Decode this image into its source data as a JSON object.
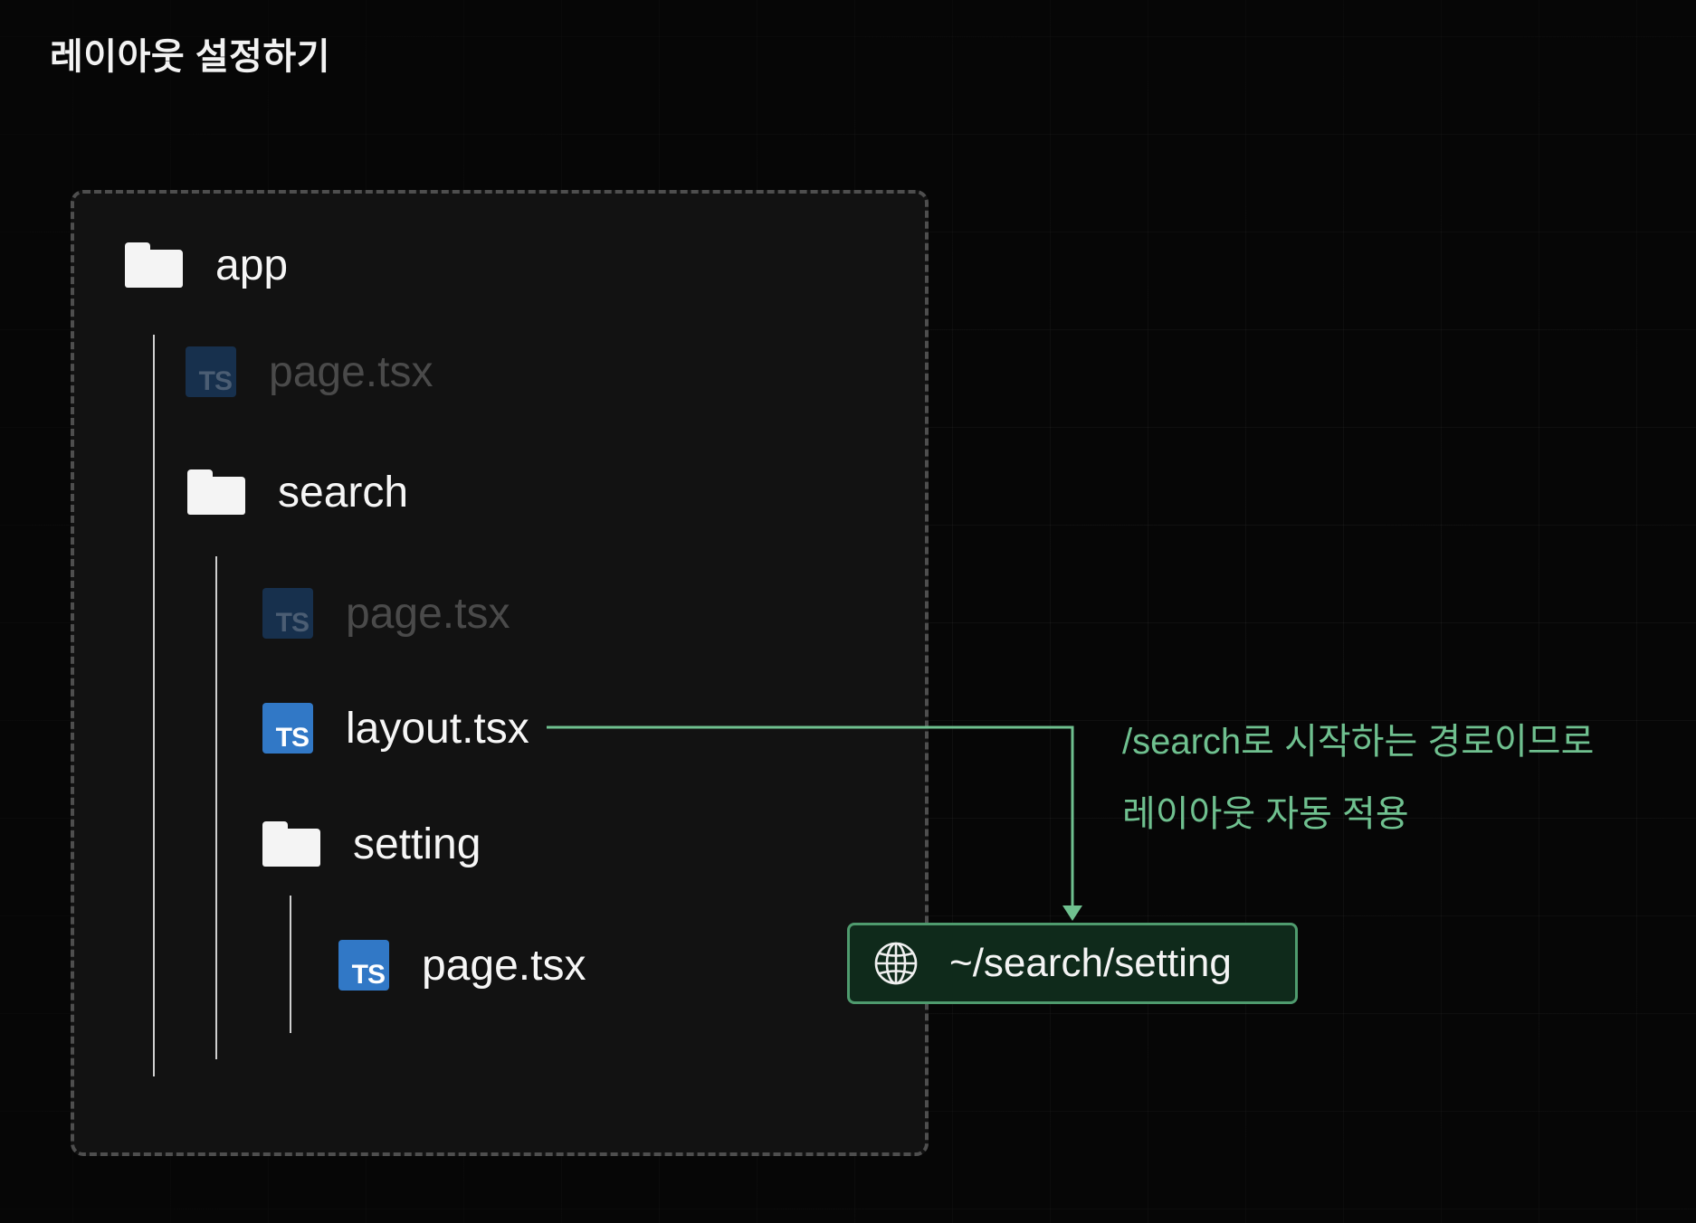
{
  "title": "레이아웃 설정하기",
  "tree": {
    "app_label": "app",
    "app_page_label": "page.tsx",
    "search_label": "search",
    "search_page_label": "page.tsx",
    "layout_label": "layout.tsx",
    "setting_label": "setting",
    "setting_page_label": "page.tsx",
    "ts_badge": "TS"
  },
  "annotation": {
    "line1": "/search로 시작하는 경로이므로",
    "line2": "레이아웃 자동 적용"
  },
  "url": {
    "text": "~/search/setting",
    "icon": "globe-icon"
  },
  "colors": {
    "background": "#060606",
    "panel": "#121212",
    "panel_border": "#4e4e4e",
    "typescript_blue": "#3178c6",
    "accent_green": "#6fc08f",
    "url_box_fill": "#0f2a1b",
    "url_box_border": "#4f9b6e"
  }
}
